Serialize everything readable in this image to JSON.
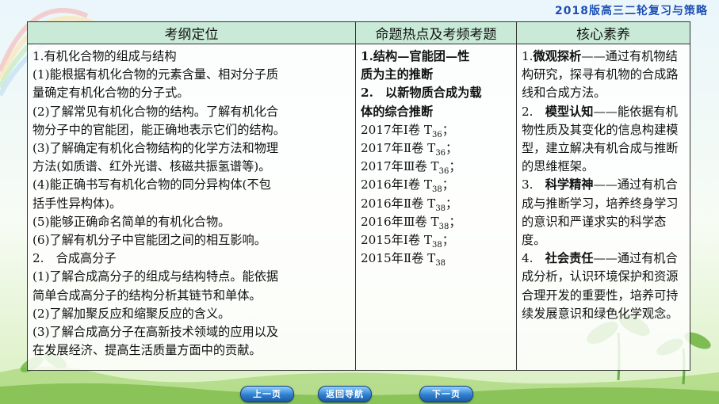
{
  "header": {
    "title": "2018版高三二轮复习与策略"
  },
  "table": {
    "headers": [
      "考纲定位",
      "命题热点及考频考题",
      "核心素养"
    ],
    "col1_lines": [
      "1.有机化合物的组成与结构",
      "(1)能根据有机化合物的元素含量、相对分子质",
      "量确定有机化合物的分子式。",
      "(2)了解常见有机化合物的结构。了解有机化合",
      "物分子中的官能团，能正确地表示它们的结构。",
      "(3)了解确定有机化合物结构的化学方法和物理",
      "方法(如质谱、红外光谱、核磁共振氢谱等)。",
      "(4)能正确书写有机化合物的同分异构体(不包",
      "括手性异构体)。",
      "(5)能够正确命名简单的有机化合物。",
      "(6)了解有机分子中官能团之间的相互影响。",
      "2.　合成高分子",
      "(1)了解合成高分子的组成与结构特点。能依据",
      "简单合成高分子的结构分析其链节和单体。",
      "(2)了解加聚反应和缩聚反应的含义。",
      "(3)了解合成高分子在高新技术领域的应用以及",
      "在发展经济、提高生活质量方面中的贡献。"
    ],
    "col2_hot": [
      "1.结构—官能团—性",
      "质为主的推断",
      "2.　以新物质合成为载",
      "体的综合推断"
    ],
    "col2_exams": [
      {
        "text": "2017年Ⅰ卷 T",
        "sub": "36",
        "tail": "；"
      },
      {
        "text": "2017年Ⅱ卷 T",
        "sub": "36",
        "tail": "；"
      },
      {
        "text": "2017年Ⅲ卷 T",
        "sub": "36",
        "tail": "；"
      },
      {
        "text": "2016年Ⅰ卷 T",
        "sub": "38",
        "tail": "；"
      },
      {
        "text": "2016年Ⅱ卷 T",
        "sub": "38",
        "tail": "；"
      },
      {
        "text": "2016年Ⅲ卷 T",
        "sub": "38",
        "tail": "；"
      },
      {
        "text": "2015年Ⅰ卷 T",
        "sub": "38",
        "tail": "；"
      },
      {
        "text": "2015年Ⅱ卷 T",
        "sub": "38",
        "tail": ""
      }
    ],
    "col3_items": [
      {
        "num": "1.",
        "keyword": "微观探析",
        "rest": "——通过有机物结构研究，探寻有机物的合成路线和合成方法。"
      },
      {
        "num": "2.　",
        "keyword": "模型认知",
        "rest": "——能依据有机物性质及其变化的信息构建模型，建立解决有机合成与推断的思维框架。"
      },
      {
        "num": "3.　",
        "keyword": "科学精神",
        "rest": "——通过有机合成与推断学习，培养终身学习的意识和严谨求实的科学态度。"
      },
      {
        "num": "4.　",
        "keyword": "社会责任",
        "rest": "——通过有机合成分析，认识环境保护和资源合理开发的重要性，培养可持续发展意识和绿色化学观念。"
      }
    ]
  },
  "nav": {
    "prev": "上一页",
    "back": "返回导航",
    "next": "下一页"
  }
}
